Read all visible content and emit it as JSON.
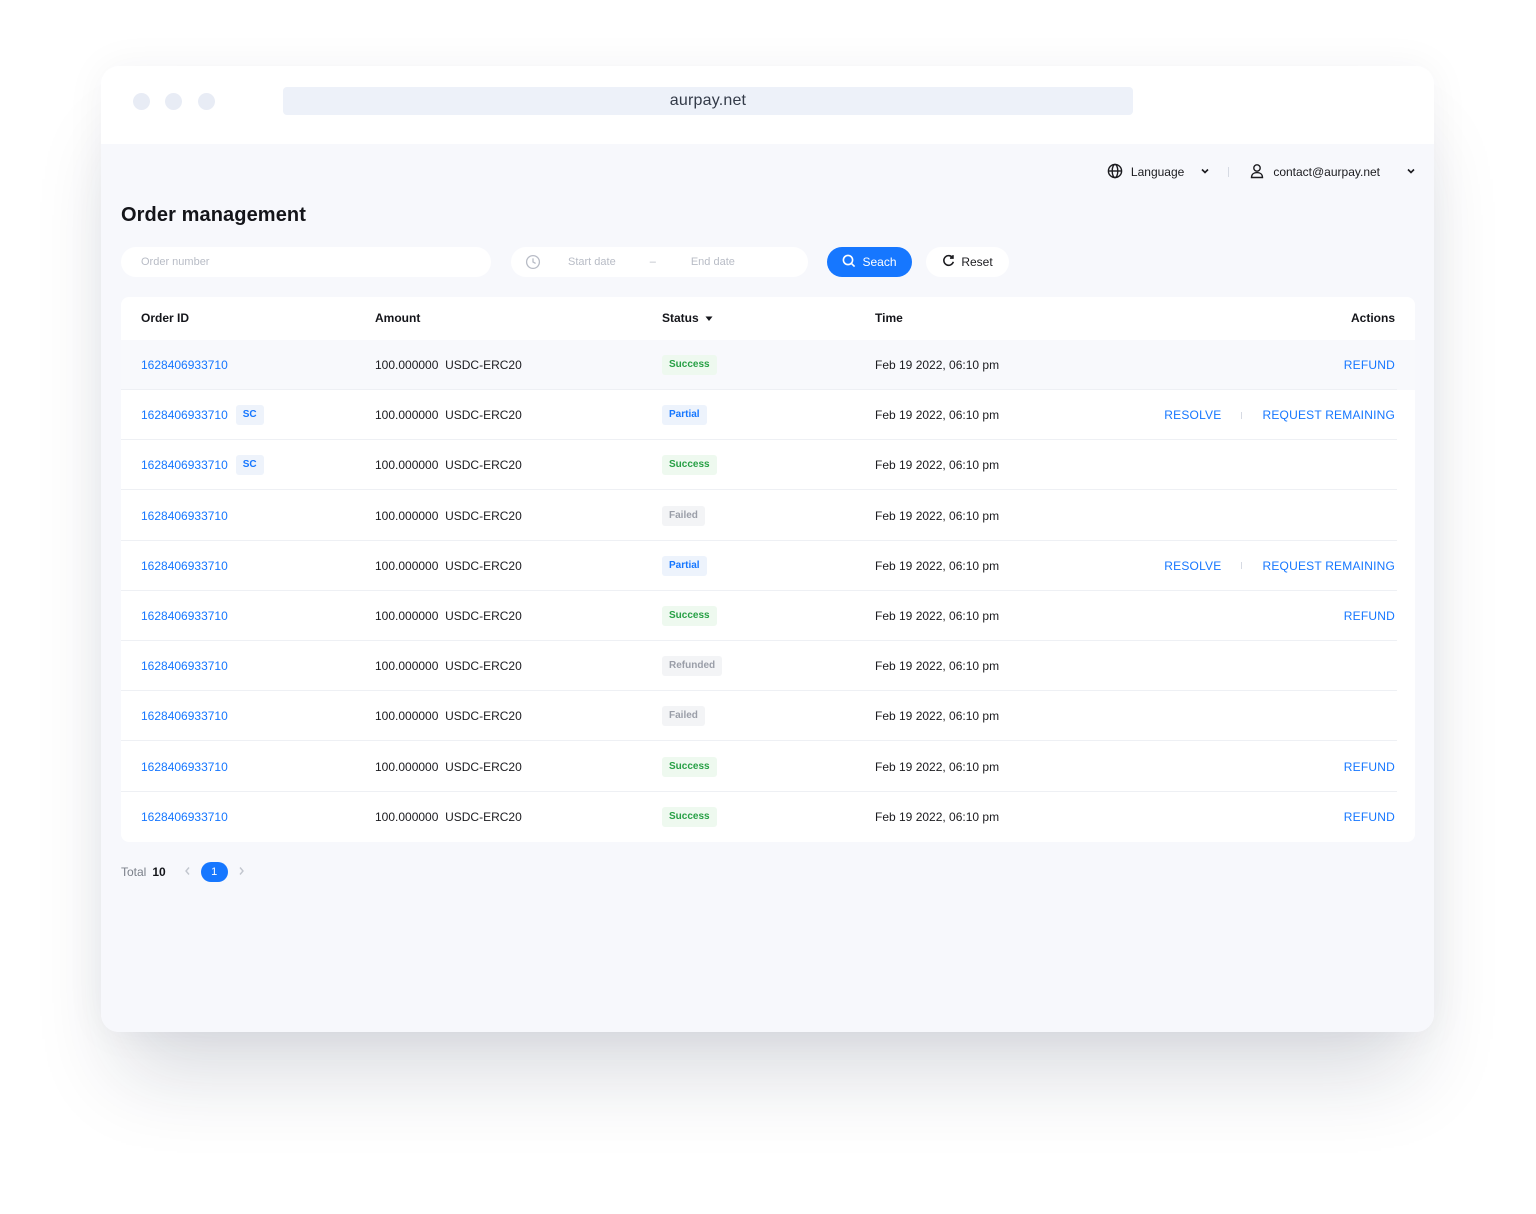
{
  "browser": {
    "url": "aurpay.net"
  },
  "topbar": {
    "language_label": "Language",
    "account_email": "contact@aurpay.net"
  },
  "page": {
    "title": "Order management"
  },
  "filters": {
    "order_placeholder": "Order number",
    "start_placeholder": "Start date",
    "range_separator": "–",
    "end_placeholder": "End date",
    "search_label": "Seach",
    "reset_label": "Reset"
  },
  "table": {
    "headers": {
      "order_id": "Order ID",
      "amount": "Amount",
      "status": "Status",
      "time": "Time",
      "actions": "Actions"
    },
    "rows": [
      {
        "order_id": "1628406933710",
        "sc": "",
        "amount": "100.000000  USDC-ERC20",
        "status": "Success",
        "time": "Feb 19 2022, 06:10 pm",
        "actions": [
          "REFUND"
        ]
      },
      {
        "order_id": "1628406933710",
        "sc": "SC",
        "amount": "100.000000  USDC-ERC20",
        "status": "Partial",
        "time": "Feb 19 2022, 06:10 pm",
        "actions": [
          "RESOLVE",
          "REQUEST REMAINING"
        ]
      },
      {
        "order_id": "1628406933710",
        "sc": "SC",
        "amount": "100.000000  USDC-ERC20",
        "status": "Success",
        "time": "Feb 19 2022, 06:10 pm",
        "actions": []
      },
      {
        "order_id": "1628406933710",
        "sc": "",
        "amount": "100.000000  USDC-ERC20",
        "status": "Failed",
        "time": "Feb 19 2022, 06:10 pm",
        "actions": []
      },
      {
        "order_id": "1628406933710",
        "sc": "",
        "amount": "100.000000  USDC-ERC20",
        "status": "Partial",
        "time": "Feb 19 2022, 06:10 pm",
        "actions": [
          "RESOLVE",
          "REQUEST REMAINING"
        ]
      },
      {
        "order_id": "1628406933710",
        "sc": "",
        "amount": "100.000000  USDC-ERC20",
        "status": "Success",
        "time": "Feb 19 2022, 06:10 pm",
        "actions": [
          "REFUND"
        ]
      },
      {
        "order_id": "1628406933710",
        "sc": "",
        "amount": "100.000000  USDC-ERC20",
        "status": "Refunded",
        "time": "Feb 19 2022, 06:10 pm",
        "actions": []
      },
      {
        "order_id": "1628406933710",
        "sc": "",
        "amount": "100.000000  USDC-ERC20",
        "status": "Failed",
        "time": "Feb 19 2022, 06:10 pm",
        "actions": []
      },
      {
        "order_id": "1628406933710",
        "sc": "",
        "amount": "100.000000  USDC-ERC20",
        "status": "Success",
        "time": "Feb 19 2022, 06:10 pm",
        "actions": [
          "REFUND"
        ]
      },
      {
        "order_id": "1628406933710",
        "sc": "",
        "amount": "100.000000  USDC-ERC20",
        "status": "Success",
        "time": "Feb 19 2022, 06:10 pm",
        "actions": [
          "REFUND"
        ]
      }
    ]
  },
  "pagination": {
    "total_label": "Total",
    "total_count": "10",
    "current_page": "1",
    "prev_icon": "chevron-left-icon",
    "next_icon": "chevron-right-icon"
  },
  "colors": {
    "accent": "#1677ff",
    "success": "#27a045",
    "muted": "#9a9ea8",
    "background": "#f7f8fc"
  }
}
